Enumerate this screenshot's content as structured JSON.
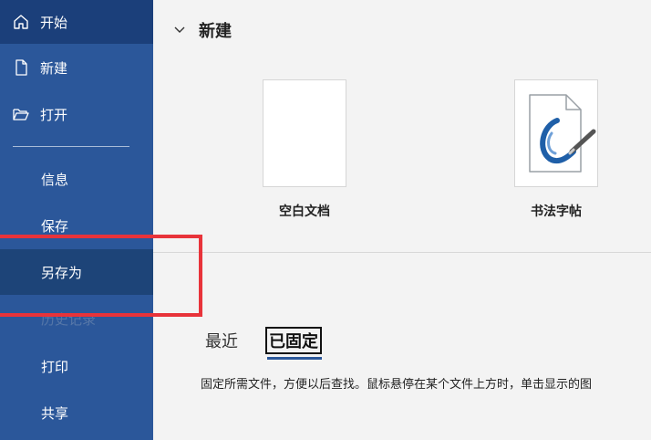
{
  "sidebar": {
    "items": [
      {
        "label": "开始",
        "icon": "home-icon"
      },
      {
        "label": "新建",
        "icon": "new-document-icon"
      },
      {
        "label": "打开",
        "icon": "open-folder-icon"
      },
      {
        "label": "信息"
      },
      {
        "label": "保存"
      },
      {
        "label": "另存为"
      },
      {
        "label": "历史记录"
      },
      {
        "label": "打印"
      },
      {
        "label": "共享"
      }
    ],
    "selected": "另存为"
  },
  "main": {
    "section_title": "新建",
    "templates": [
      {
        "name": "空白文档"
      },
      {
        "name": "书法字帖"
      }
    ],
    "tabs": [
      {
        "label": "最近"
      },
      {
        "label": "已固定"
      }
    ],
    "active_tab": "已固定",
    "description": "固定所需文件，方便以后查找。鼠标悬停在某个文件上方时，单击显示的图"
  },
  "colors": {
    "sidebar_bg": "#2b579a",
    "sidebar_selected": "#1d4478",
    "highlight_box": "#e8333a",
    "tab_underline": "#2b579a"
  }
}
